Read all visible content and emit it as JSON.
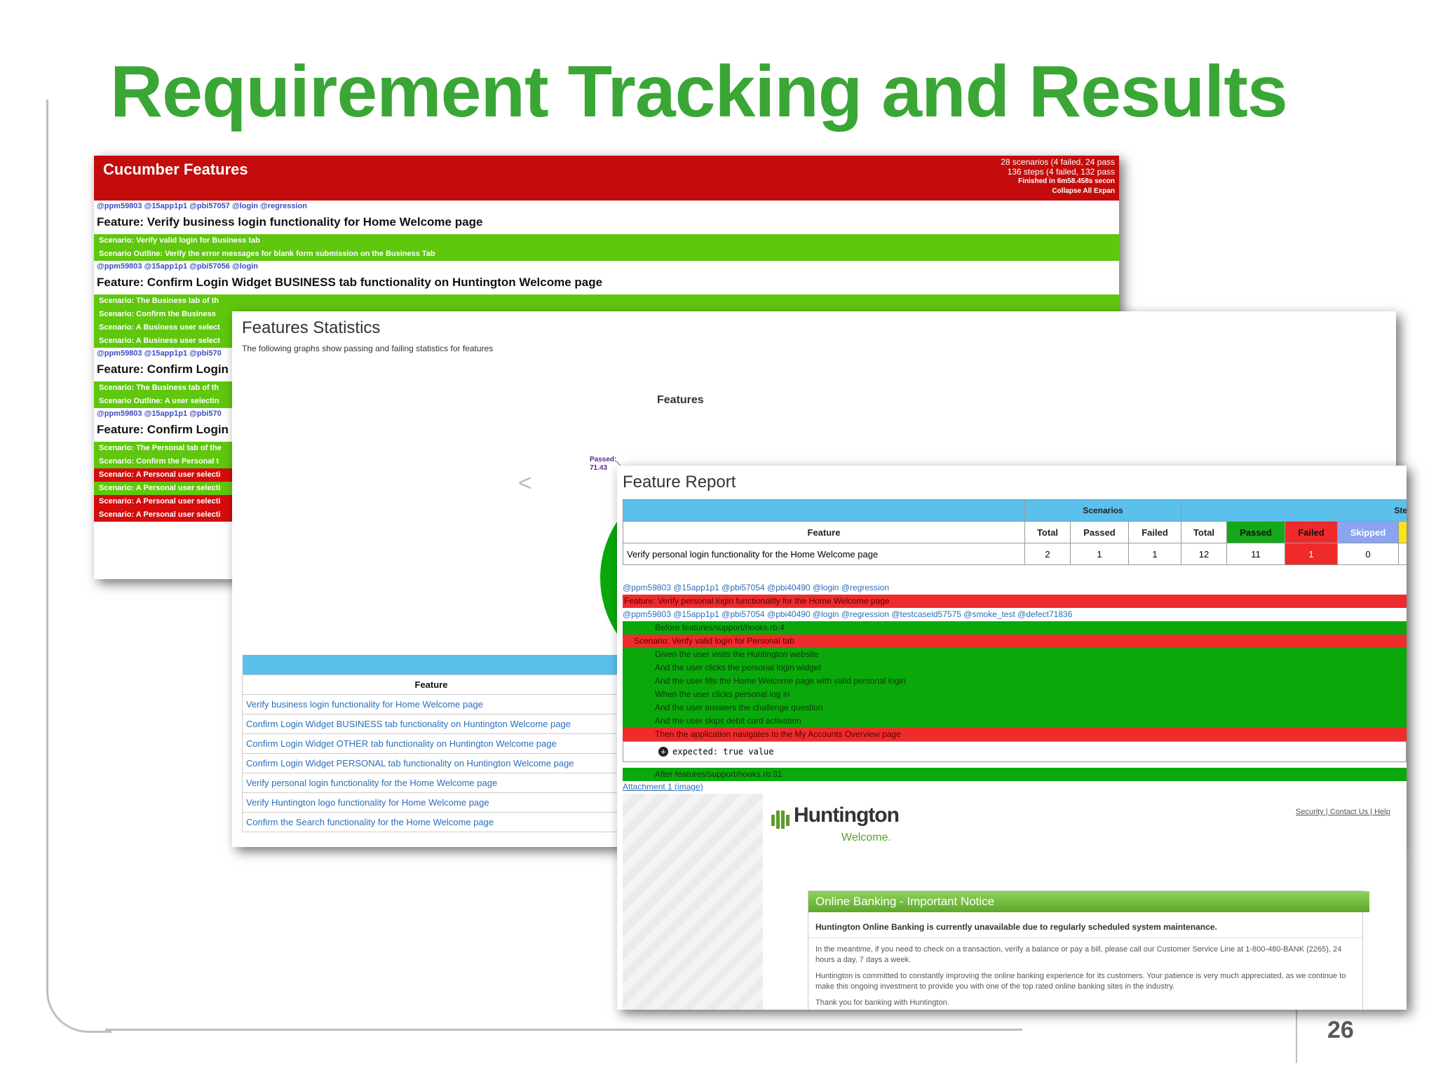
{
  "slide": {
    "title": "Requirement Tracking and Results",
    "page_number": "26"
  },
  "colors": {
    "title_green": "#3aa635",
    "header_red": "#c40c0c",
    "pass_green": "#17a81a",
    "fail_red": "#ef2a2a",
    "table_blue": "#5bc0eb"
  },
  "cucumber": {
    "title": "Cucumber Features",
    "stats": [
      "28 scenarios (4 failed, 24 pass",
      "136 steps (4 failed, 132 pass",
      "Finished in 6m58.458s secon",
      "Collapse All   Expan"
    ],
    "features": [
      {
        "tags": "@ppm59803 @15app1p1 @pbi57057 @login @regression",
        "title": "Feature: Verify business login functionality for Home Welcome page",
        "scenarios": [
          {
            "text": "Scenario: Verify valid login for Business tab",
            "status": "pass"
          },
          {
            "text": "Scenario Outline: Verify the error messages for blank form submission on the Business Tab",
            "status": "pass"
          }
        ]
      },
      {
        "tags": "@ppm59803 @15app1p1 @pbi57056 @login",
        "title": "Feature: Confirm Login Widget BUSINESS tab functionality on Huntington Welcome page",
        "scenarios": [
          {
            "text": "Scenario: The Business tab of th",
            "status": "pass"
          },
          {
            "text": "Scenario: Confirm the Business",
            "status": "pass"
          },
          {
            "text": "Scenario: A Business user select",
            "status": "pass"
          },
          {
            "text": "Scenario: A Business user select",
            "status": "pass"
          }
        ]
      },
      {
        "tags": "@ppm59803 @15app1p1 @pbi570",
        "title": "Feature: Confirm Login",
        "scenarios": [
          {
            "text": "Scenario: The Business tab of th",
            "status": "pass"
          },
          {
            "text": "Scenario Outline: A user selectin",
            "status": "pass"
          }
        ]
      },
      {
        "tags": "@ppm59803 @15app1p1 @pbi570",
        "title": "Feature: Confirm Login",
        "scenarios": [
          {
            "text": "Scenario: The Personal tab of the",
            "status": "pass"
          },
          {
            "text": "Scenario: Confirm the Personal t",
            "status": "pass"
          },
          {
            "text": "Scenario: A Personal user selecti",
            "status": "fail"
          },
          {
            "text": "Scenario: A Personal user selecti",
            "status": "pass"
          },
          {
            "text": "Scenario: A Personal user selecti",
            "status": "fail"
          },
          {
            "text": "Scenario: A Personal user selecti",
            "status": "fail"
          }
        ]
      }
    ]
  },
  "statistics": {
    "title": "Features Statistics",
    "subtitle": "The following graphs show passing and failing statistics for features",
    "chart_title": "Features",
    "nav_arrow": "<",
    "passed_label": "Passed:",
    "passed_value": "71.43",
    "table_header": "Feature",
    "features": [
      "Verify business login functionality for Home Welcome page",
      "Confirm Login Widget BUSINESS tab functionality on Huntington Welcome page",
      "Confirm Login Widget OTHER tab functionality on Huntington Welcome page",
      "Confirm Login Widget PERSONAL tab functionality on Huntington Welcome page",
      "Verify personal login functionality for the Home Welcome page",
      "Verify Huntington logo functionality for Home Welcome page",
      "Confirm the Search functionality for the Home Welcome page"
    ]
  },
  "report": {
    "title": "Feature Report",
    "groups": {
      "scenarios": "Scenarios",
      "steps": "Steps"
    },
    "columns": {
      "feature": "Feature",
      "total": "Total",
      "passed": "Passed",
      "failed": "Failed",
      "total2": "Total",
      "passed2": "Passed",
      "failed2": "Failed",
      "skipped": "Skipped"
    },
    "row": {
      "feature": "Verify personal login functionality for the Home Welcome page",
      "sc_total": "2",
      "sc_passed": "1",
      "sc_failed": "1",
      "st_total": "12",
      "st_passed": "11",
      "st_failed": "1",
      "st_skipped": "0"
    },
    "tags1": "@ppm59803 @15app1p1 @pbi57054 @pbi40490 @login @regression",
    "feature_line": "Feature: Verify personal login functionality for the Home Welcome page",
    "tags2": "@ppm59803 @15app1p1 @pbi57054 @pbi40490 @login @regression @testcaseid57575 @smoke_test @defect71836",
    "before_line": "Before features/support/hooks.rb:4",
    "scenario_line": "Scenario: Verify valid login for Personal tab",
    "steps": [
      {
        "text": "Given the user visits the Huntington website",
        "status": "pass"
      },
      {
        "text": "And the user clicks the personal login widget",
        "status": "pass"
      },
      {
        "text": "And the user fills the Home Welcome page with valid personal login",
        "status": "pass"
      },
      {
        "text": "When the user clicks personal log in",
        "status": "pass"
      },
      {
        "text": "And the user answers the challenge question",
        "status": "pass"
      },
      {
        "text": "And the user skips debit card activation",
        "status": "pass"
      },
      {
        "text": "Then the application navigates to the My Accounts Overview page",
        "status": "fail"
      }
    ],
    "expected": "expected: true value",
    "after_line": "After features/support/hooks.rb:31",
    "attachment": "Attachment 1 (image)"
  },
  "huntington": {
    "logo": "Huntington",
    "welcome": "Welcome.",
    "links": "Security | Contact Us | Help",
    "notice_title": "Online Banking - Important Notice",
    "notice_strong": "Huntington Online Banking is currently unavailable due to regularly scheduled system maintenance.",
    "para1": "In the meantime, if you need to check on a transaction, verify a balance or pay a bill, please call our Customer Service Line at 1-800-480-BANK (2265), 24 hours a day, 7 days a week.",
    "para2": "Huntington is committed to constantly improving the online banking experience for its customers. Your patience is very much appreciated, as we continue to make this ongoing investment to provide you with one of the top rated online banking sites in the industry.",
    "para3": "Thank you for banking with Huntington."
  }
}
